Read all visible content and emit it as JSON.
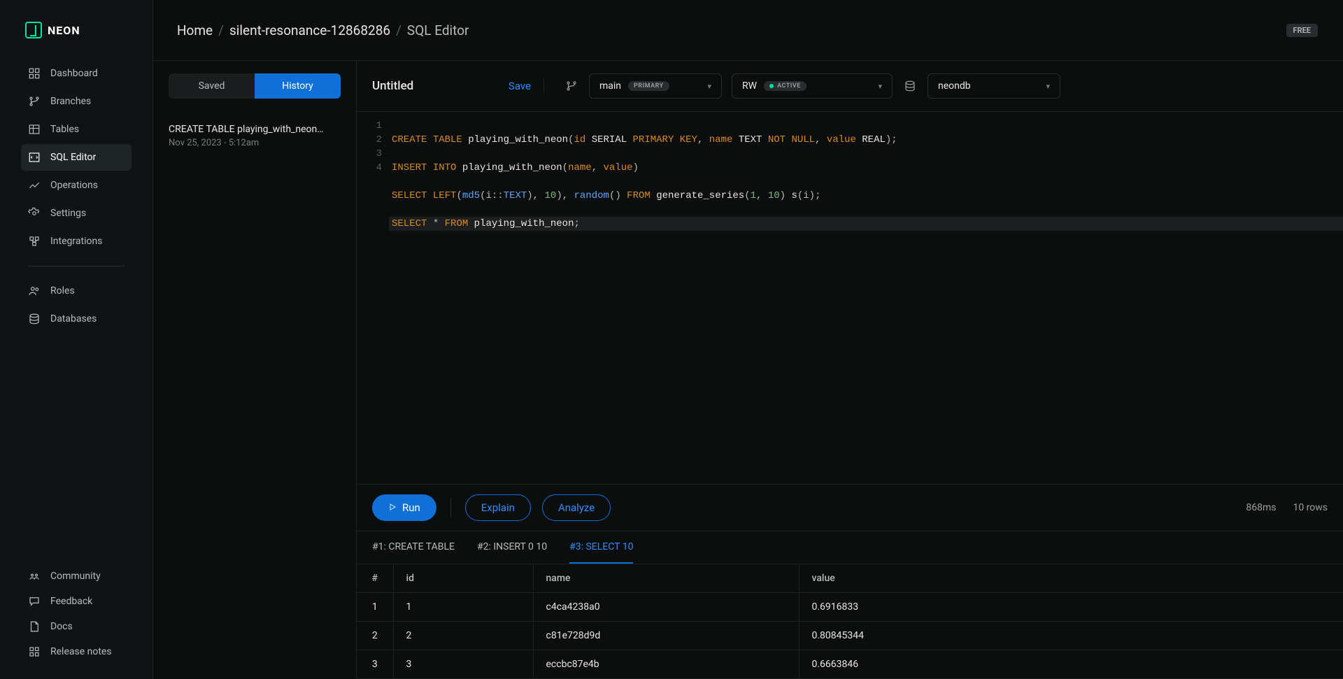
{
  "brand": "NEON",
  "plan_badge": "FREE",
  "breadcrumb": {
    "home": "Home",
    "project": "silent-resonance-12868286",
    "page": "SQL Editor"
  },
  "sidebar": {
    "items": [
      {
        "label": "Dashboard",
        "icon": "dashboard-icon"
      },
      {
        "label": "Branches",
        "icon": "branches-icon"
      },
      {
        "label": "Tables",
        "icon": "tables-icon"
      },
      {
        "label": "SQL Editor",
        "icon": "sql-editor-icon"
      },
      {
        "label": "Operations",
        "icon": "operations-icon"
      },
      {
        "label": "Settings",
        "icon": "settings-icon"
      },
      {
        "label": "Integrations",
        "icon": "integrations-icon"
      },
      {
        "label": "Roles",
        "icon": "roles-icon"
      },
      {
        "label": "Databases",
        "icon": "databases-icon"
      }
    ],
    "bottom": [
      {
        "label": "Community",
        "icon": "community-icon"
      },
      {
        "label": "Feedback",
        "icon": "feedback-icon"
      },
      {
        "label": "Docs",
        "icon": "docs-icon"
      },
      {
        "label": "Release notes",
        "icon": "release-notes-icon"
      }
    ]
  },
  "leftpane": {
    "tab_saved": "Saved",
    "tab_history": "History",
    "history": {
      "title": "CREATE TABLE playing_with_neon…",
      "date": "Nov 25, 2023 - 5:12am"
    }
  },
  "editor": {
    "title": "Untitled",
    "save": "Save",
    "branch_label": "main",
    "branch_badge": "PRIMARY",
    "compute_label": "RW",
    "compute_badge": "ACTIVE",
    "db_label": "neondb",
    "code": {
      "line1": "CREATE TABLE playing_with_neon(id SERIAL PRIMARY KEY, name TEXT NOT NULL, value REAL);",
      "line2": "INSERT INTO playing_with_neon(name, value)",
      "line3": "SELECT LEFT(md5(i::TEXT), 10), random() FROM generate_series(1, 10) s(i);",
      "line4": "SELECT * FROM playing_with_neon;"
    }
  },
  "runbar": {
    "run": "Run",
    "explain": "Explain",
    "analyze": "Analyze",
    "time": "868ms",
    "rows": "10 rows"
  },
  "result_tabs": {
    "t1": "#1: CREATE TABLE",
    "t2": "#2: INSERT 0 10",
    "t3": "#3: SELECT 10"
  },
  "table": {
    "headers": {
      "h0": "#",
      "h1": "id",
      "h2": "name",
      "h3": "value"
    },
    "rows": [
      {
        "n": "1",
        "id": "1",
        "name": "c4ca4238a0",
        "value": "0.6916833"
      },
      {
        "n": "2",
        "id": "2",
        "name": "c81e728d9d",
        "value": "0.80845344"
      },
      {
        "n": "3",
        "id": "3",
        "name": "eccbc87e4b",
        "value": "0.6663846"
      }
    ]
  }
}
